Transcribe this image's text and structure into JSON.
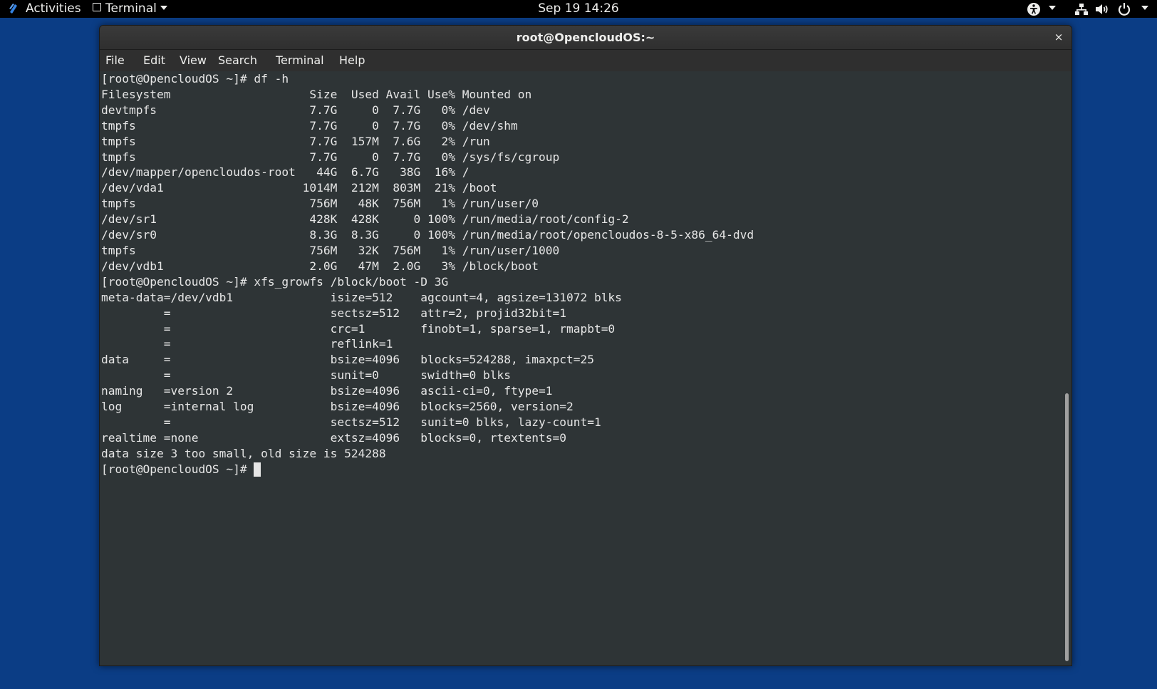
{
  "topbar": {
    "activities": "Activities",
    "app_menu": "Terminal",
    "clock": "Sep 19  14:26",
    "icons": [
      "activities-logo-icon",
      "accessibility-icon",
      "network-icon",
      "volume-icon",
      "power-icon"
    ]
  },
  "window": {
    "title": "root@OpencloudOS:~",
    "close_glyph": "×"
  },
  "menubar": {
    "items": [
      "File",
      "Edit",
      "View",
      "Search",
      "Terminal",
      "Help"
    ]
  },
  "terminal": {
    "lines": [
      "[root@OpencloudOS ~]# df -h",
      "Filesystem                    Size  Used Avail Use% Mounted on",
      "devtmpfs                      7.7G     0  7.7G   0% /dev",
      "tmpfs                         7.7G     0  7.7G   0% /dev/shm",
      "tmpfs                         7.7G  157M  7.6G   2% /run",
      "tmpfs                         7.7G     0  7.7G   0% /sys/fs/cgroup",
      "/dev/mapper/opencloudos-root   44G  6.7G   38G  16% /",
      "/dev/vda1                    1014M  212M  803M  21% /boot",
      "tmpfs                         756M   48K  756M   1% /run/user/0",
      "/dev/sr1                      428K  428K     0 100% /run/media/root/config-2",
      "/dev/sr0                      8.3G  8.3G     0 100% /run/media/root/opencloudos-8-5-x86_64-dvd",
      "tmpfs                         756M   32K  756M   1% /run/user/1000",
      "/dev/vdb1                     2.0G   47M  2.0G   3% /block/boot",
      "[root@OpencloudOS ~]# xfs_growfs /block/boot -D 3G",
      "meta-data=/dev/vdb1              isize=512    agcount=4, agsize=131072 blks",
      "         =                       sectsz=512   attr=2, projid32bit=1",
      "         =                       crc=1        finobt=1, sparse=1, rmapbt=0",
      "         =                       reflink=1",
      "data     =                       bsize=4096   blocks=524288, imaxpct=25",
      "         =                       sunit=0      swidth=0 blks",
      "naming   =version 2              bsize=4096   ascii-ci=0, ftype=1",
      "log      =internal log           bsize=4096   blocks=2560, version=2",
      "         =                       sectsz=512   sunit=0 blks, lazy-count=1",
      "realtime =none                   extsz=4096   blocks=0, rtextents=0",
      "data size 3 too small, old size is 524288"
    ],
    "current_prompt": "[root@OpencloudOS ~]# "
  },
  "colors": {
    "desktop": "#0b3d85",
    "terminal_bg": "#2e3436",
    "terminal_fg": "#e6e6e6",
    "topbar_bg": "#000000"
  }
}
